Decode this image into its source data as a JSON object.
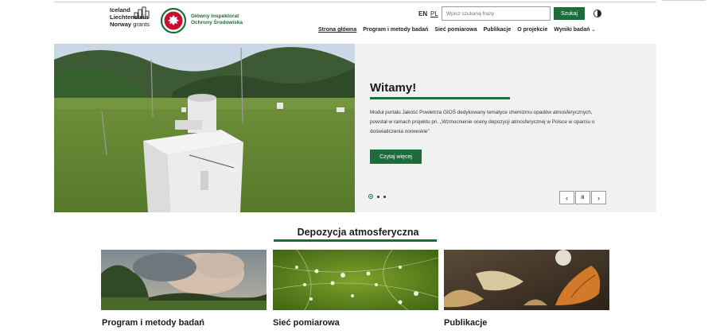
{
  "header": {
    "eea_logo": {
      "line1": "Iceland",
      "line2": "Liechtenstein",
      "line3_bold": "Norway",
      "line3_rest": "grants"
    },
    "gios_logo": {
      "line1": "Główny Inspektorat",
      "line2": "Ochrony Środowiska"
    },
    "lang_en": "EN",
    "lang_pl": "PL",
    "search_placeholder": "Wpisz szukaną frazę",
    "search_button": "Szukaj",
    "contrast_icon": "contrast-icon"
  },
  "nav": {
    "items": [
      {
        "label": "Strona główna",
        "active": true
      },
      {
        "label": "Program i metody badań"
      },
      {
        "label": "Sieć pomiarowa"
      },
      {
        "label": "Publikacje"
      },
      {
        "label": "O projekcie"
      },
      {
        "label": "Wyniki badań"
      }
    ],
    "dropdown_icon": "chevron-down-icon"
  },
  "hero": {
    "title": "Witamy!",
    "text": "Moduł portalu Jakość Powietrza GIOŚ dedykowany tematyce chemizmu opadów atmosferycznych, powstał w ramach projektu pn. „Wzmocnienie oceny depozycji atmosferycznej w Polsce w oparciu o doświadczenia norweskie\"",
    "button": "Czytaj więcej",
    "slide_count": 3,
    "active_slide": 1,
    "prev_icon": "chevron-left-icon",
    "pause_icon": "pause-icon",
    "next_icon": "chevron-right-icon",
    "prev_glyph": "‹",
    "pause_glyph": "II",
    "next_glyph": "›"
  },
  "section": {
    "title": "Depozycja atmosferyczna",
    "cards": [
      {
        "title": "Program i metody badań",
        "image": "storm-clouds-over-forest"
      },
      {
        "title": "Sieć pomiarowa",
        "image": "dew-drops-on-spider-web"
      },
      {
        "title": "Publikacje",
        "image": "autumn-oak-leaves"
      }
    ]
  },
  "colors": {
    "accent": "#1e6b3c",
    "panel": "#f1f1f1"
  }
}
